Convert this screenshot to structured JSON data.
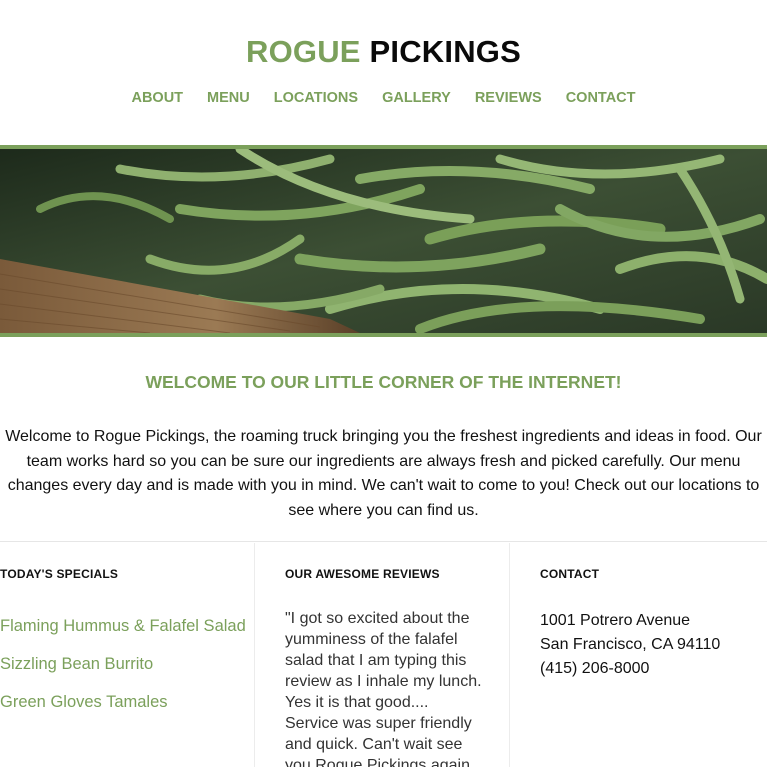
{
  "brand": {
    "part1": "ROGUE",
    "part2": "PICKINGS"
  },
  "nav": [
    "ABOUT",
    "MENU",
    "LOCATIONS",
    "GALLERY",
    "REVIEWS",
    "CONTACT"
  ],
  "hero": {
    "description": "green beans photo"
  },
  "welcome": {
    "title": "WELCOME TO OUR LITTLE CORNER OF THE INTERNET!",
    "lines": [
      "Welcome to Rogue Pickings, the roaming truck bringing you the freshest ingredients and ideas in food. Our",
      "team works hard so you can be sure our ingredients are always fresh and picked carefully. Our menu",
      "changes every day and is made with you in mind. We can't wait to come to you! Check out our locations to",
      "see where you can find us."
    ]
  },
  "specials": {
    "heading": "TODAY'S SPECIALS",
    "items": [
      "Flaming Hummus & Falafel Salad",
      "Sizzling Bean Burrito",
      "Green Gloves Tamales"
    ]
  },
  "reviews": {
    "heading": "OUR AWESOME REVIEWS",
    "text": "\"I got so excited about the yumminess of the falafel salad that I am typing this review as I inhale my lunch. Yes it is that good.... Service was super friendly and quick. Can't wait see you Rogue Pickings again"
  },
  "contact": {
    "heading": "CONTACT",
    "address": "1001 Potrero Avenue",
    "city": "San Francisco, CA 94110",
    "phone": "(415) 206-8000"
  },
  "colors": {
    "accent": "#7ba05b",
    "text": "#111111"
  }
}
